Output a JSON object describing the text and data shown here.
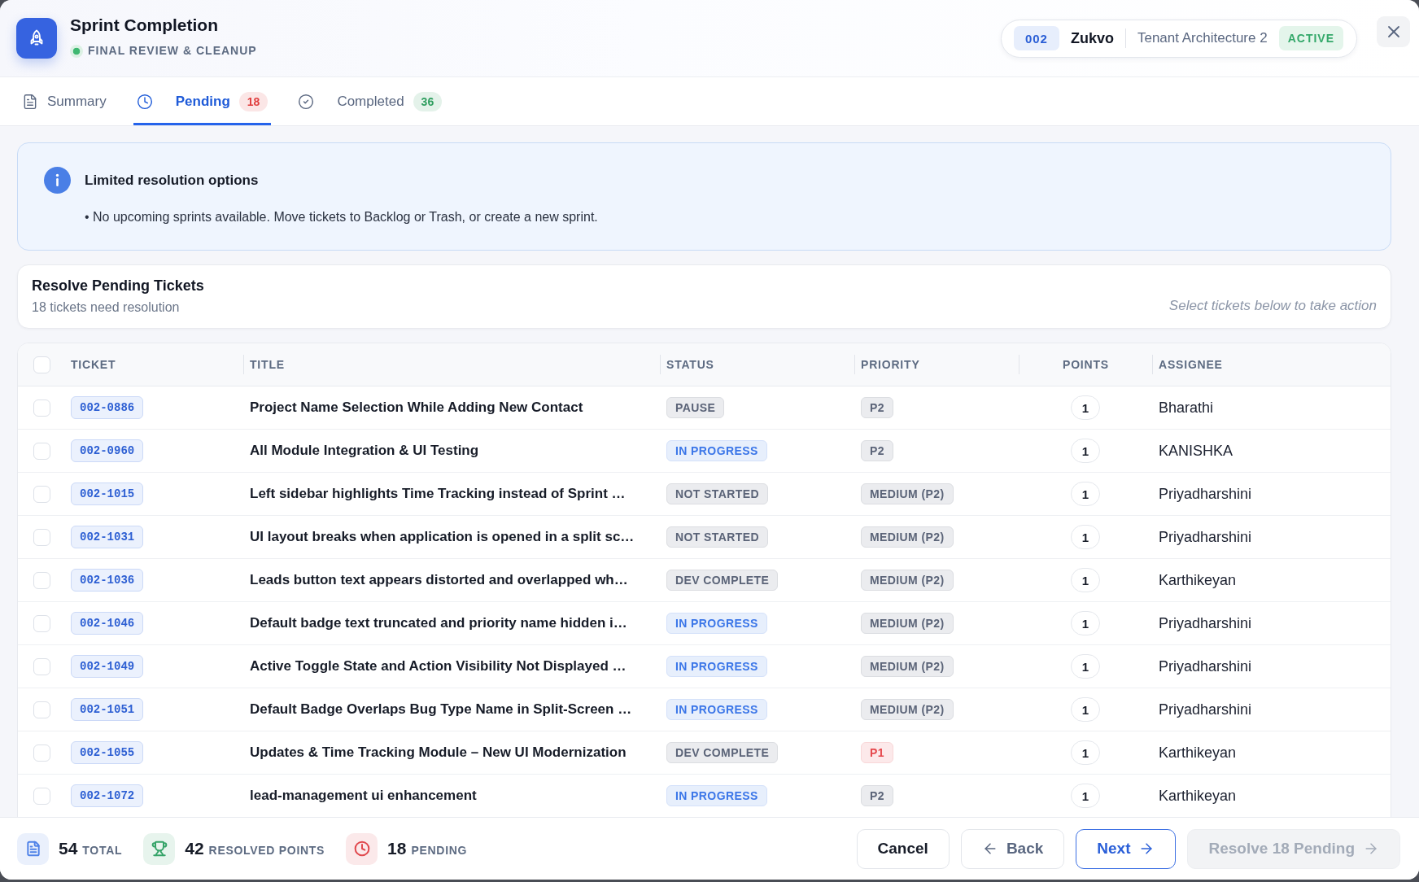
{
  "header": {
    "title": "Sprint Completion",
    "subtitle": "FINAL REVIEW & CLEANUP",
    "sprint": {
      "number": "002",
      "project": "Zukvo",
      "name": "Tenant Architecture 2",
      "status": "ACTIVE"
    }
  },
  "tabs": [
    {
      "label": "Summary",
      "selected": false
    },
    {
      "label": "Pending",
      "selected": true,
      "badge": {
        "text": "18",
        "color": "#e03e3e"
      }
    },
    {
      "label": "Completed",
      "selected": false,
      "badge": {
        "text": "36",
        "color": "#2f9e5f"
      }
    }
  ],
  "notice": {
    "title": "Limited resolution options",
    "text": "• No upcoming sprints available. Move tickets to Backlog or Trash, or create a new sprint."
  },
  "resolve_card": {
    "title": "Resolve Pending Tickets",
    "subtitle": "18 tickets need resolution",
    "hint": "Select tickets below to take action"
  },
  "table": {
    "select_all": {
      "checked": false
    },
    "columns": [
      "TICKET",
      "TITLE",
      "STATUS",
      "PRIORITY",
      "POINTS",
      "ASSIGNEE"
    ],
    "rows": [
      {
        "checked": false,
        "ticket": "002-0886",
        "title": "Project Name Selection While Adding New Contact",
        "status": {
          "label": "PAUSE",
          "color": "#5b6478"
        },
        "priority": {
          "label": "P2",
          "color": "#5b6478"
        },
        "points": "1",
        "assignee": "Bharathi"
      },
      {
        "checked": false,
        "ticket": "002-0960",
        "title": "All Module Integration & UI Testing",
        "status": {
          "label": "IN PROGRESS",
          "color": "#3b76e8"
        },
        "priority": {
          "label": "P2",
          "color": "#5b6478"
        },
        "points": "1",
        "assignee": "KANISHKA"
      },
      {
        "checked": false,
        "ticket": "002-1015",
        "title": "Left sidebar highlights Time Tracking instead of Sprint …",
        "status": {
          "label": "NOT STARTED",
          "color": "#5b6478"
        },
        "priority": {
          "label": "MEDIUM (P2)",
          "color": "#5b6478"
        },
        "points": "1",
        "assignee": "Priyadharshini"
      },
      {
        "checked": false,
        "ticket": "002-1031",
        "title": "UI layout breaks when application is opened in a split sc…",
        "status": {
          "label": "NOT STARTED",
          "color": "#5b6478"
        },
        "priority": {
          "label": "MEDIUM (P2)",
          "color": "#5b6478"
        },
        "points": "1",
        "assignee": "Priyadharshini"
      },
      {
        "checked": false,
        "ticket": "002-1036",
        "title": "Leads button text appears distorted and overlapped wh…",
        "status": {
          "label": "DEV COMPLETE",
          "color": "#5b6478"
        },
        "priority": {
          "label": "MEDIUM (P2)",
          "color": "#5b6478"
        },
        "points": "1",
        "assignee": "Karthikeyan"
      },
      {
        "checked": false,
        "ticket": "002-1046",
        "title": "Default badge text truncated and priority name hidden i…",
        "status": {
          "label": "IN PROGRESS",
          "color": "#3b76e8"
        },
        "priority": {
          "label": "MEDIUM (P2)",
          "color": "#5b6478"
        },
        "points": "1",
        "assignee": "Priyadharshini"
      },
      {
        "checked": false,
        "ticket": "002-1049",
        "title": "Active Toggle State and Action Visibility Not Displayed …",
        "status": {
          "label": "IN PROGRESS",
          "color": "#3b76e8"
        },
        "priority": {
          "label": "MEDIUM (P2)",
          "color": "#5b6478"
        },
        "points": "1",
        "assignee": "Priyadharshini"
      },
      {
        "checked": false,
        "ticket": "002-1051",
        "title": "Default Badge Overlaps Bug Type Name in Split-Screen …",
        "status": {
          "label": "IN PROGRESS",
          "color": "#3b76e8"
        },
        "priority": {
          "label": "MEDIUM (P2)",
          "color": "#5b6478"
        },
        "points": "1",
        "assignee": "Priyadharshini"
      },
      {
        "checked": false,
        "ticket": "002-1055",
        "title": "Updates & Time Tracking Module – New UI Modernization",
        "status": {
          "label": "DEV COMPLETE",
          "color": "#5b6478"
        },
        "priority": {
          "label": "P1",
          "color": "#e5484d"
        },
        "points": "1",
        "assignee": "Karthikeyan"
      },
      {
        "checked": false,
        "ticket": "002-1072",
        "title": "lead-management ui enhancement",
        "status": {
          "label": "IN PROGRESS",
          "color": "#3b76e8"
        },
        "priority": {
          "label": "P2",
          "color": "#5b6478"
        },
        "points": "1",
        "assignee": "Karthikeyan"
      }
    ]
  },
  "footer": {
    "stats": [
      {
        "value": "54",
        "label": "TOTAL",
        "color": "#4f82e8"
      },
      {
        "value": "42",
        "label": "RESOLVED POINTS",
        "color": "#35a368"
      },
      {
        "value": "18",
        "label": "PENDING",
        "color": "#e0484d"
      }
    ],
    "buttons": [
      {
        "label": "Cancel",
        "kind": "plain",
        "disabled": false
      },
      {
        "label": "Back",
        "kind": "back",
        "disabled": false
      },
      {
        "label": "Next",
        "kind": "outline",
        "disabled": false
      },
      {
        "label": "Resolve 18 Pending",
        "kind": "solid",
        "disabled": true
      }
    ]
  }
}
